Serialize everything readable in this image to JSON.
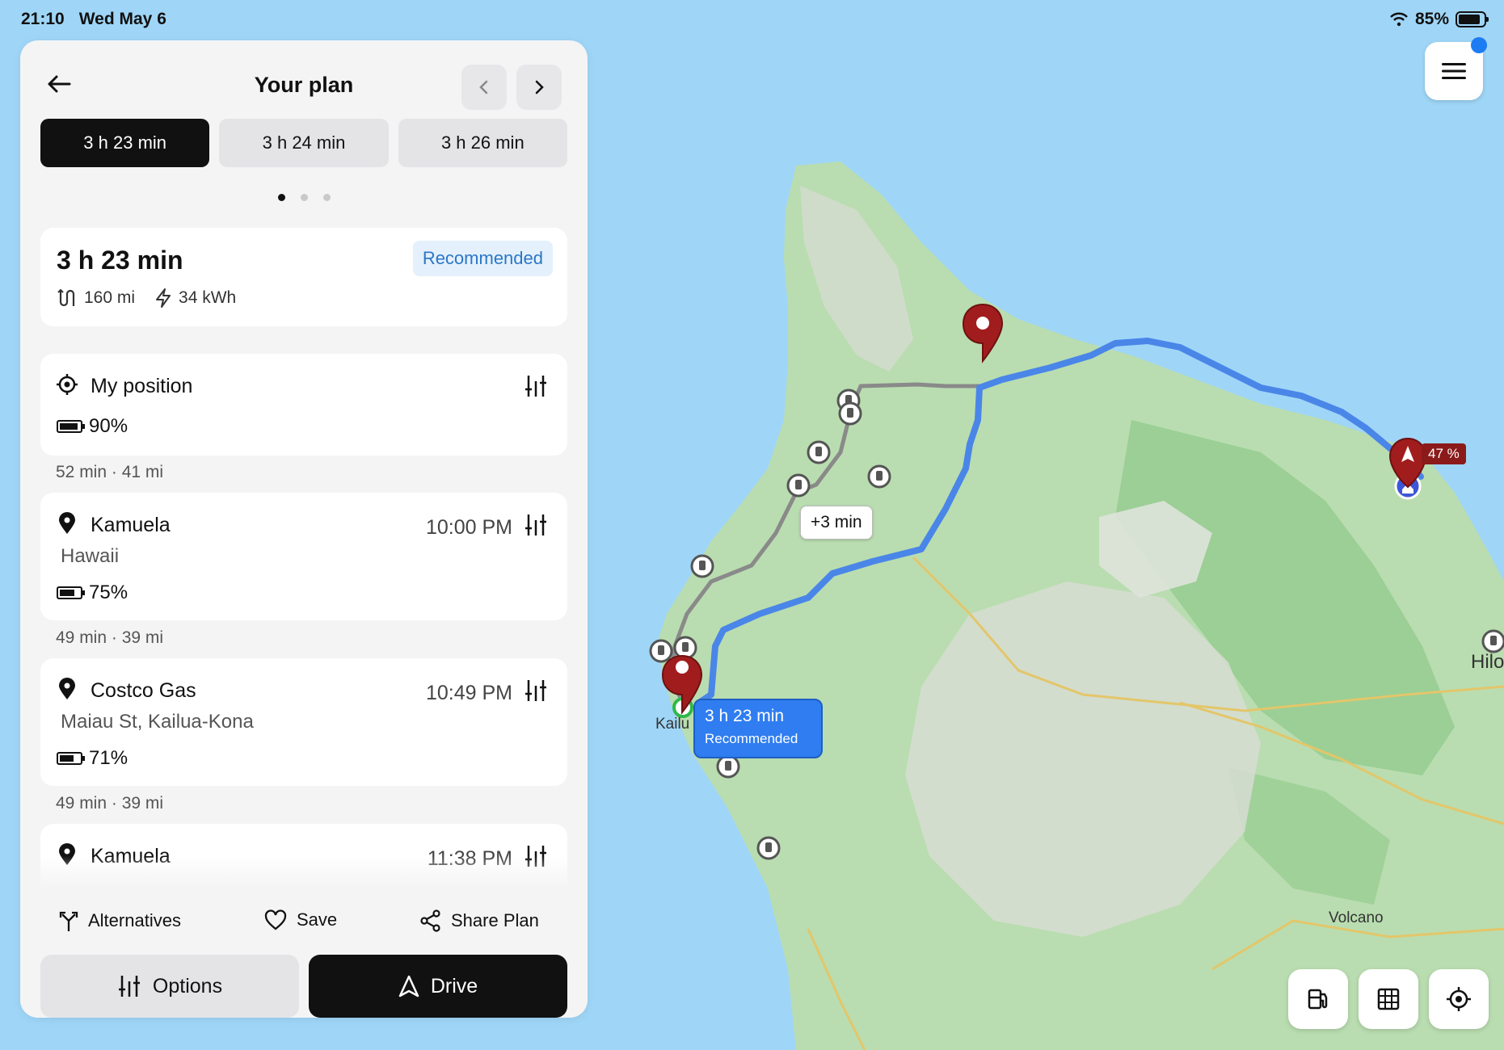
{
  "status_bar": {
    "time": "21:10",
    "date": "Wed May 6",
    "battery": "85%",
    "battery_level": 0.85
  },
  "header": {
    "title": "Your plan"
  },
  "route_tabs": [
    {
      "label": "3 h 23 min",
      "active": true
    },
    {
      "label": "3 h 24 min",
      "active": false
    },
    {
      "label": "3 h 26 min",
      "active": false
    }
  ],
  "pager": {
    "count": 3,
    "active_index": 0
  },
  "summary": {
    "time": "3 h 23 min",
    "badge": "Recommended",
    "distance": "160 mi",
    "energy": "34 kWh"
  },
  "stops": [
    {
      "name": "My position",
      "icon": "crosshair-icon",
      "battery": "90%",
      "battery_level": 0.9
    },
    {
      "segment": "52 min · 41 mi"
    },
    {
      "name": "Kamuela",
      "icon": "location-pin-icon",
      "subtitle": "Hawaii",
      "time": "10:00 PM",
      "battery": "75%",
      "battery_level": 0.75
    },
    {
      "segment": "49 min · 39 mi"
    },
    {
      "name": "Costco Gas",
      "icon": "location-pin-icon",
      "subtitle": "Maiau St,  Kailua-Kona",
      "time": "10:49 PM",
      "battery": "71%",
      "battery_level": 0.71
    },
    {
      "segment": "49 min · 39 mi"
    },
    {
      "name": "Kamuela",
      "icon": "location-pin-icon",
      "time": "11:38 PM"
    }
  ],
  "actions": {
    "alternatives": "Alternatives",
    "save": "Save",
    "share": "Share Plan"
  },
  "buttons": {
    "options": "Options",
    "drive": "Drive"
  },
  "map": {
    "labels": {
      "kailua": "Kailu",
      "hilo": "Hilo",
      "volcano": "Volcano"
    },
    "alt_route_delta": "+3 min",
    "callout": {
      "time": "3 h 23 min",
      "label": "Recommended"
    },
    "destination_soc": "47 %"
  },
  "colors": {
    "route": "#4a86e8",
    "alt_route": "#8a8a8a",
    "marker": "#a11d1d",
    "land": "#b9ddb0",
    "sea": "#9fd6f7",
    "accent": "#2a77c8"
  }
}
